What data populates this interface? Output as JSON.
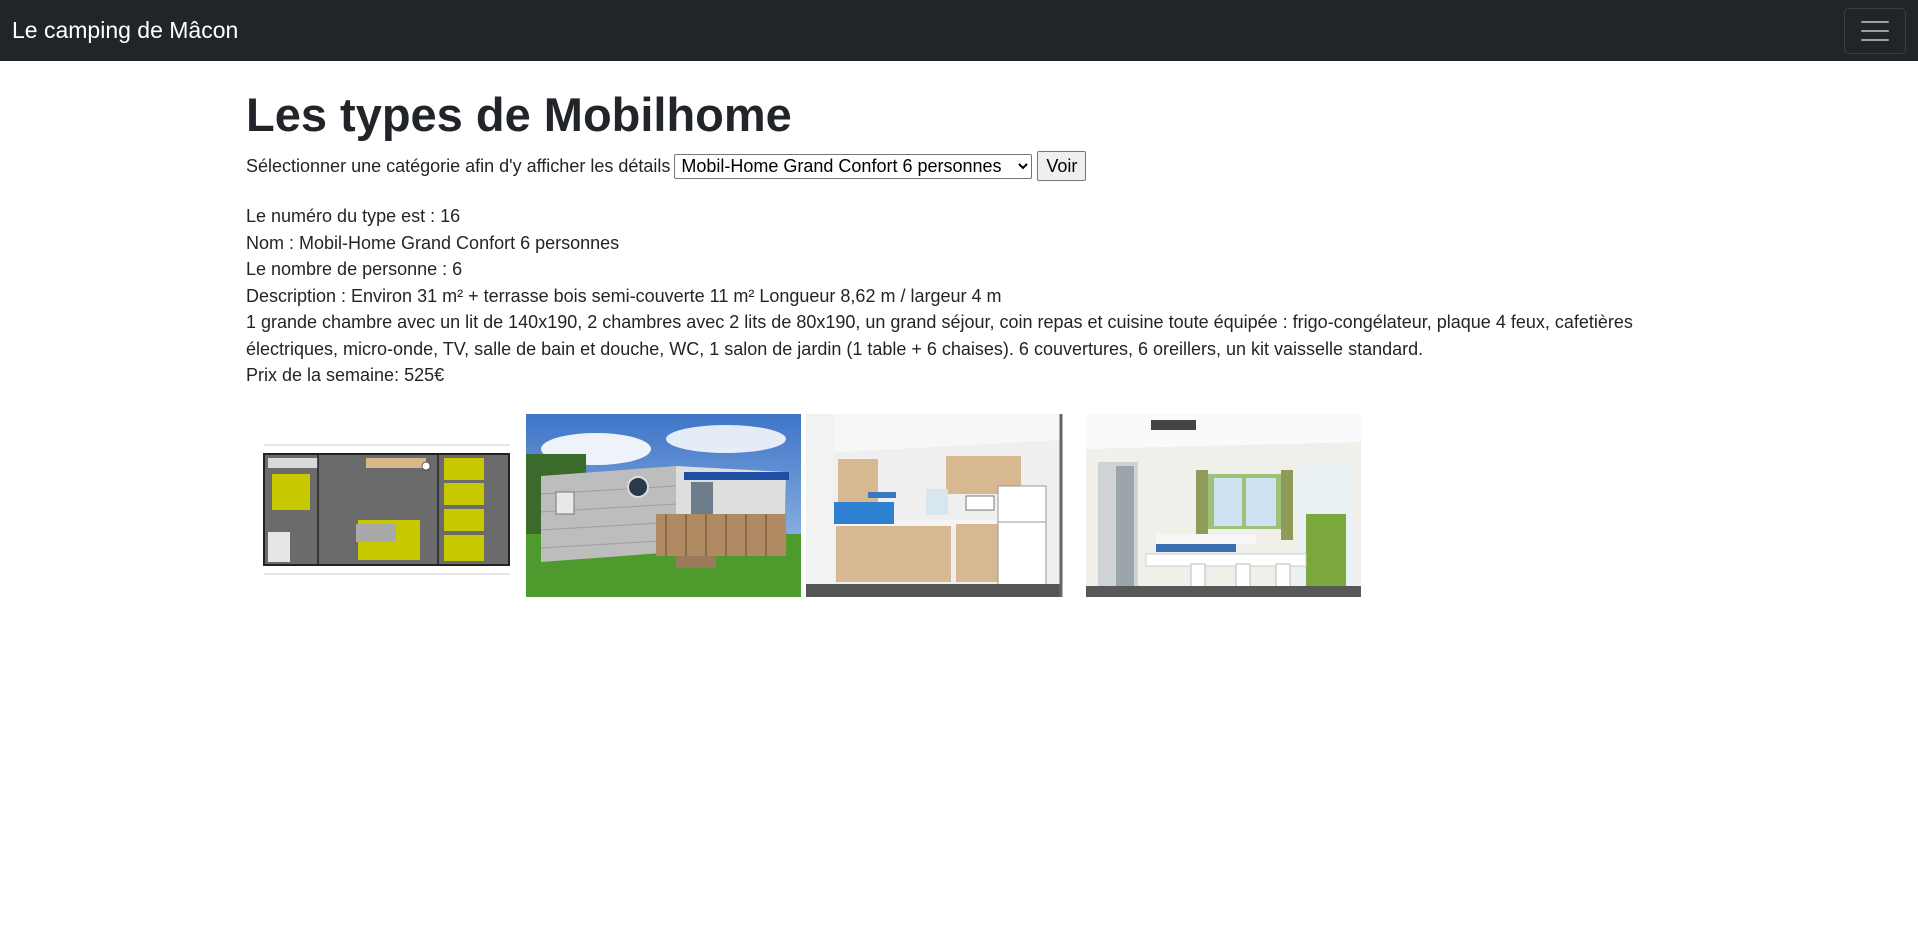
{
  "navbar": {
    "brand": "Le camping de Mâcon",
    "toggler_icon": "hamburger-icon"
  },
  "page": {
    "title": "Les types de Mobilhome",
    "select_label": "Sélectionner une catégorie afin d'y afficher les détails",
    "select_value": "Mobil-Home Grand Confort 6 personnes",
    "submit_label": "Voir"
  },
  "details": {
    "type_number": "Le numéro du type est : 16",
    "name": "Nom : Mobil-Home Grand Confort 6 personnes",
    "people": "Le nombre de personne : 6",
    "description": "Description : Environ 31 m² + terrasse bois semi-couverte 11 m² Longueur 8,62 m / largeur 4 m",
    "description_more": "1 grande chambre avec un lit de 140x190, 2 chambres avec 2 lits de 80x190, un grand séjour, coin repas et cuisine toute équipée : frigo-congélateur, plaque 4 feux, cafetières électriques, micro-onde, TV, salle de bain et douche, WC, 1 salon de jardin (1 table + 6 chaises). 6 couvertures, 6 oreillers, un kit vaisselle standard.",
    "price": "Prix de la semaine: 525€"
  },
  "gallery": [
    {
      "kind": "floor-plan"
    },
    {
      "kind": "exterior"
    },
    {
      "kind": "kitchen"
    },
    {
      "kind": "living-room"
    }
  ]
}
